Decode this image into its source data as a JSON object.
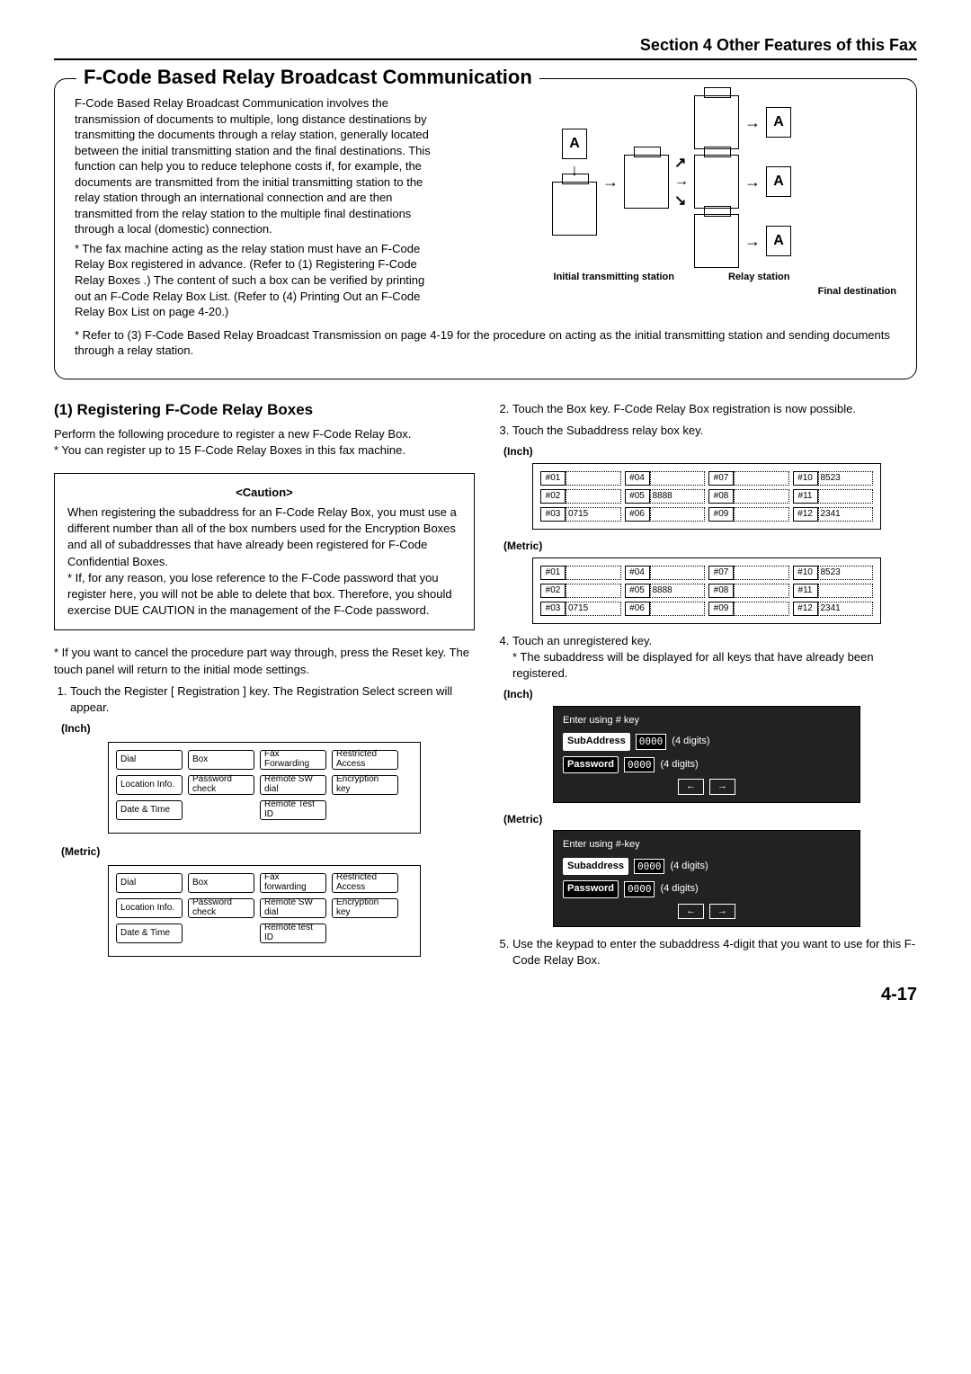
{
  "header": "Section 4 Other Features of this Fax",
  "main_title": "F-Code Based Relay Broadcast Communication",
  "intro_paragraph": "F-Code Based Relay Broadcast Communication involves the transmission of documents to multiple, long distance destinations by transmitting the documents through a relay station, generally located between the initial transmitting station and the final destinations. This function can help you to reduce telephone costs if, for example, the documents are transmitted from the initial transmitting station to the relay station through an international connection and are then transmitted from the relay station to the multiple final destinations through a local (domestic) connection.",
  "intro_bullet1": "* The fax machine acting as the relay station must have an F-Code Relay Box registered in advance. (Refer to (1) Registering F-Code Relay Boxes .) The content of such a box can be verified by printing out an F-Code Relay Box List. (Refer to (4) Printing Out an F-Code Relay Box List on page 4-20.)",
  "intro_bullet2": "* Refer to (3) F-Code Based Relay Broadcast Transmission on page 4-19 for the procedure on acting as the initial transmitting station and sending documents through a relay station.",
  "diagram_labels": {
    "initial": "Initial transmitting station",
    "relay": "Relay station",
    "final": "Final destination"
  },
  "left": {
    "heading": "(1) Registering F-Code Relay Boxes",
    "lead": "Perform the following procedure to register a new F-Code Relay Box.",
    "note1": "* You can register up to 15 F-Code Relay Boxes in this fax machine.",
    "caution_title": "<Caution>",
    "caution_body": "When registering the subaddress for an F-Code Relay Box, you must use a different number than all of the box numbers used for the Encryption Boxes and all of subaddresses that have already been registered for F-Code Confidential Boxes.",
    "caution_bullet": "* If, for any reason, you lose reference to the F-Code password that you register here, you will not be able to delete that box. Therefore, you should exercise DUE CAUTION in the management of the F-Code password.",
    "note2": "* If you want to cancel the procedure part way through, press the Reset key. The touch panel will return to the initial mode settings.",
    "step1": "Touch the Register [ Registration ] key. The Registration Select screen will appear.",
    "inch_label": "(Inch)",
    "metric_label": "(Metric)",
    "screen_inch": {
      "r1": [
        "Dial",
        "Box",
        "Fax Forwarding",
        "Restricted Access"
      ],
      "r2": [
        "Location Info.",
        "Password check",
        "Remote SW dial",
        "Encryption key"
      ],
      "r3": [
        "Date & Time",
        "",
        "Remote Test ID",
        ""
      ]
    },
    "screen_metric": {
      "r1": [
        "Dial",
        "Box",
        "Fax forwarding",
        "Restricted Access"
      ],
      "r2": [
        "Location Info.",
        "Password check",
        "Remote SW dial",
        "Encryption key"
      ],
      "r3": [
        "Date & Time",
        "",
        "Remote test ID",
        ""
      ]
    }
  },
  "right": {
    "step2": "Touch the Box key. F-Code Relay Box registration is now possible.",
    "step3": "Touch the Subaddress relay box key.",
    "inch_label": "(Inch)",
    "metric_label": "(Metric)",
    "panel": {
      "rows": [
        [
          [
            "#01",
            ""
          ],
          [
            "#04",
            ""
          ],
          [
            "#07",
            ""
          ],
          [
            "#10",
            "8523"
          ]
        ],
        [
          [
            "#02",
            ""
          ],
          [
            "#05",
            "8888"
          ],
          [
            "#08",
            ""
          ],
          [
            "#11",
            ""
          ]
        ],
        [
          [
            "#03",
            "0715"
          ],
          [
            "#06",
            ""
          ],
          [
            "#09",
            ""
          ],
          [
            "#12",
            "2341"
          ]
        ]
      ]
    },
    "step4": "Touch an unregistered key.",
    "step4_note": "* The subaddress will be displayed for all keys that have already been registered.",
    "entry_inch": {
      "title": "Enter using # key",
      "sub_label": "SubAddress",
      "sub_val": "0000",
      "sub_hint": "(4 digits)",
      "pw_label": "Password",
      "pw_val": "0000",
      "pw_hint": "(4 digits)"
    },
    "entry_metric": {
      "title": "Enter using #-key",
      "sub_label": "Subaddress",
      "sub_val": "0000",
      "sub_hint": "(4 digits)",
      "pw_label": "Password",
      "pw_val": "0000",
      "pw_hint": "(4 digits)"
    },
    "step5": "Use the keypad to enter the subaddress 4-digit that you want to use for this F-Code Relay Box."
  },
  "page_number": "4-17"
}
